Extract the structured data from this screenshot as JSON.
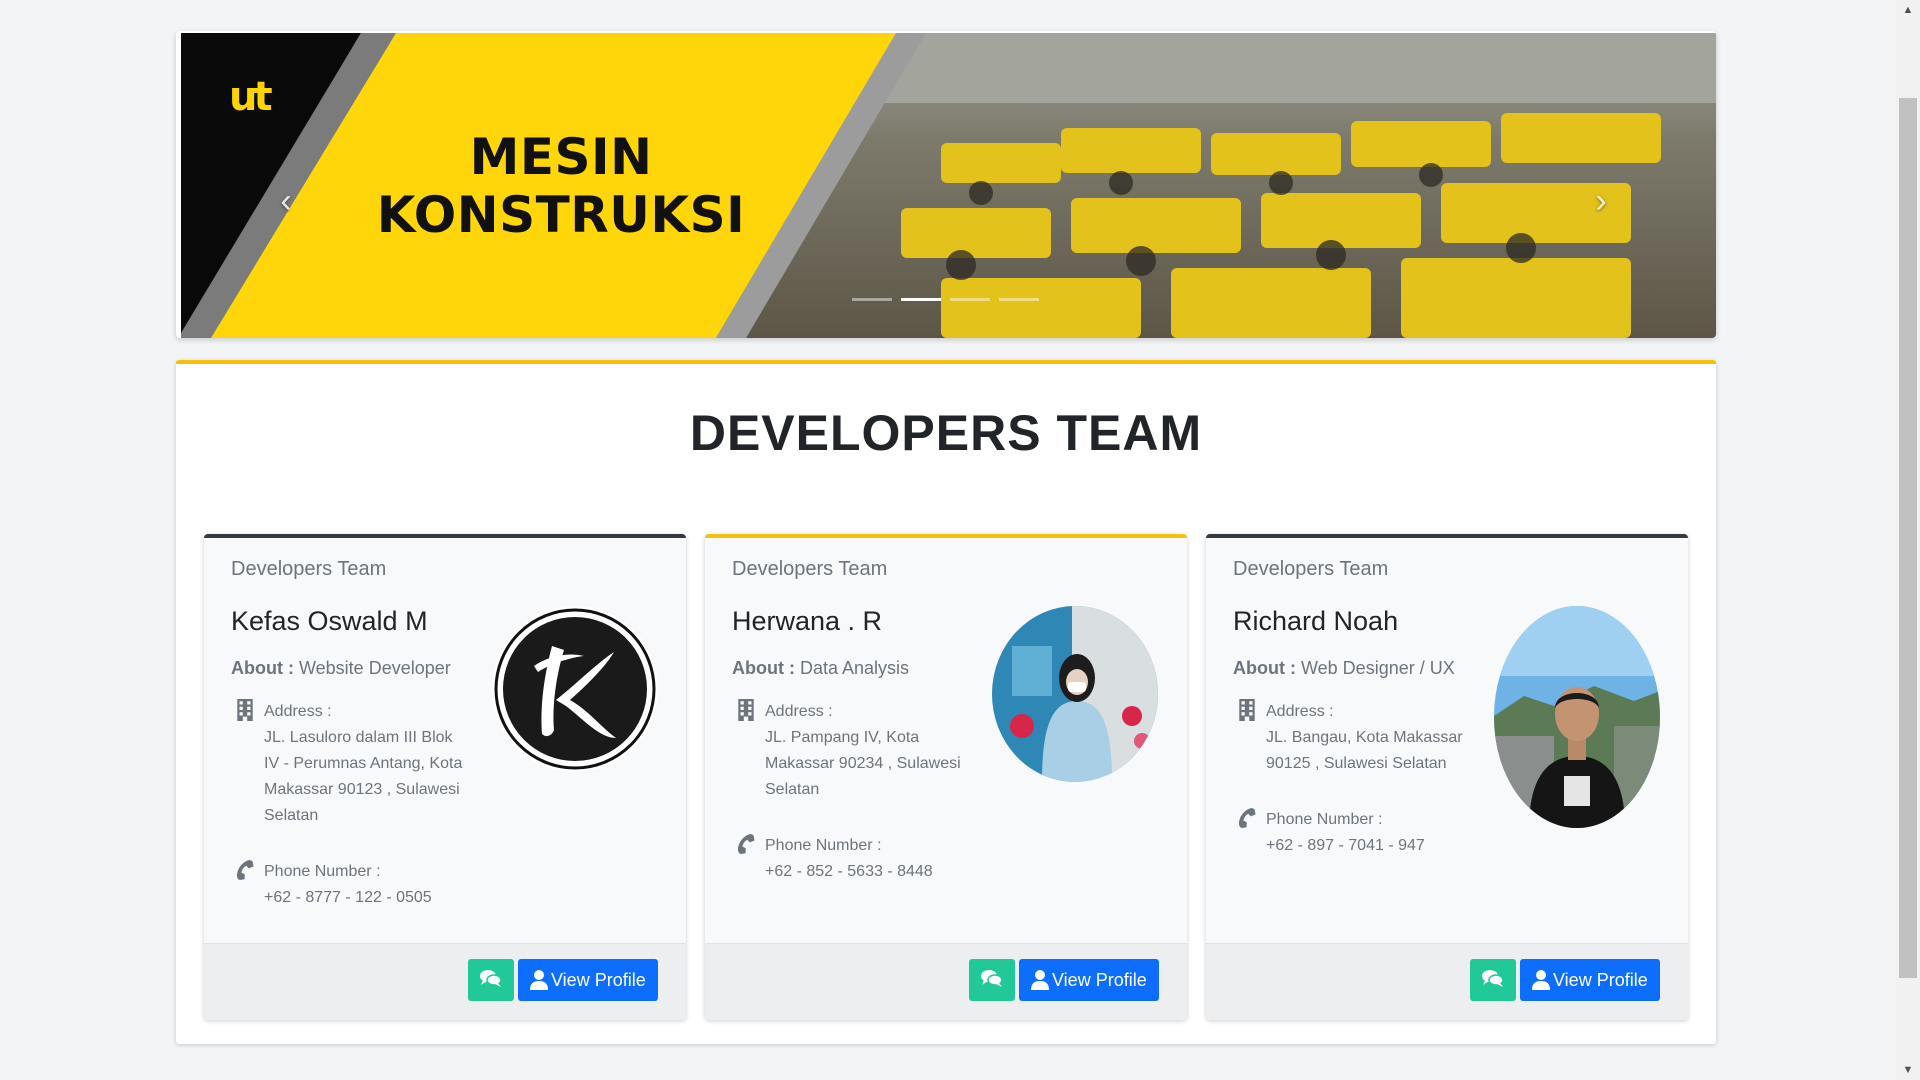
{
  "banner": {
    "title_line1": "MESIN",
    "title_line2": "KONSTRUKSI",
    "logo_text": "ut",
    "prev_icon": "chevron-left-icon",
    "next_icon": "chevron-right-icon",
    "slide_count": 4,
    "active_slide": 2
  },
  "section": {
    "title": "DEVELOPERS TEAM"
  },
  "cards": [
    {
      "header": "Developers Team",
      "name": "Kefas Oswald M",
      "about_label": "About :",
      "about_value": "Website Developer",
      "address_label": "Address :",
      "address_value": "JL. Lasuloro dalam III Blok IV - Perumnas Antang, Kota Makassar 90123 , Sulawesi Selatan",
      "phone_label": "Phone Number :",
      "phone_value": "+62 - 8777 - 122 - 0505",
      "view_profile": "View Profile"
    },
    {
      "header": "Developers Team",
      "name": "Herwana . R",
      "about_label": "About :",
      "about_value": "Data Analysis",
      "address_label": "Address :",
      "address_value": "JL. Pampang IV, Kota Makassar 90234 , Sulawesi Selatan",
      "phone_label": "Phone Number :",
      "phone_value": "+62 - 852 - 5633 - 8448",
      "view_profile": "View Profile"
    },
    {
      "header": "Developers Team",
      "name": "Richard Noah",
      "about_label": "About :",
      "about_value": "Web Designer / UX",
      "address_label": "Address :",
      "address_value": "JL. Bangau, Kota Makassar 90125 , Sulawesi Selatan",
      "phone_label": "Phone Number :",
      "phone_value": "+62 - 897 - 7041 - 947",
      "view_profile": "View Profile"
    }
  ],
  "colors": {
    "accent": "#f6c10e",
    "primary": "#0d6efd",
    "chat": "#20c997",
    "dark_top": "#343a40"
  }
}
